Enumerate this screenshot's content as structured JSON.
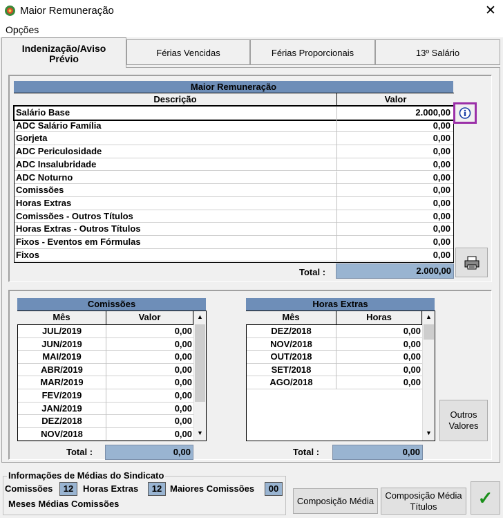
{
  "window": {
    "title": "Maior Remuneração",
    "close": "✕"
  },
  "menu": {
    "opcoes": "Opções"
  },
  "tabs": [
    {
      "label_line1": "Indenização/Aviso",
      "label_line2": "Prévio"
    },
    {
      "label": "Férias Vencidas"
    },
    {
      "label": "Férias Proporcionais"
    },
    {
      "label": "13º Salário"
    }
  ],
  "maior": {
    "title": "Maior Remuneração",
    "col_desc": "Descrição",
    "col_valor": "Valor",
    "rows": [
      {
        "desc": "Salário Base",
        "valor": "2.000,00"
      },
      {
        "desc": "ADC Salário Família",
        "valor": "0,00"
      },
      {
        "desc": "Gorjeta",
        "valor": "0,00"
      },
      {
        "desc": "ADC Periculosidade",
        "valor": "0,00"
      },
      {
        "desc": "ADC Insalubridade",
        "valor": "0,00"
      },
      {
        "desc": "ADC Noturno",
        "valor": "0,00"
      },
      {
        "desc": "Comissões",
        "valor": "0,00"
      },
      {
        "desc": "Horas Extras",
        "valor": "0,00"
      },
      {
        "desc": "Comissões - Outros Títulos",
        "valor": "0,00"
      },
      {
        "desc": "Horas Extras - Outros Títulos",
        "valor": "0,00"
      },
      {
        "desc": "Fixos - Eventos em Fórmulas",
        "valor": "0,00"
      },
      {
        "desc": "Fixos",
        "valor": "0,00"
      }
    ],
    "total_label": "Total :",
    "total_value": "2.000,00"
  },
  "comissoes": {
    "title": "Comissões",
    "col_mes": "Mês",
    "col_valor": "Valor",
    "rows": [
      {
        "mes": "JUL/2019",
        "valor": "0,00"
      },
      {
        "mes": "JUN/2019",
        "valor": "0,00"
      },
      {
        "mes": "MAI/2019",
        "valor": "0,00"
      },
      {
        "mes": "ABR/2019",
        "valor": "0,00"
      },
      {
        "mes": "MAR/2019",
        "valor": "0,00"
      },
      {
        "mes": "FEV/2019",
        "valor": "0,00"
      },
      {
        "mes": "JAN/2019",
        "valor": "0,00"
      },
      {
        "mes": "DEZ/2018",
        "valor": "0,00"
      },
      {
        "mes": "NOV/2018",
        "valor": "0,00"
      }
    ],
    "total_label": "Total :",
    "total_value": "0,00"
  },
  "horas": {
    "title": "Horas Extras",
    "col_mes": "Mês",
    "col_horas": "Horas",
    "rows": [
      {
        "mes": "DEZ/2018",
        "horas": "0,00"
      },
      {
        "mes": "NOV/2018",
        "horas": "0,00"
      },
      {
        "mes": "OUT/2018",
        "horas": "0,00"
      },
      {
        "mes": "SET/2018",
        "horas": "0,00"
      },
      {
        "mes": "AGO/2018",
        "horas": "0,00"
      }
    ],
    "total_label": "Total :",
    "total_value": "0,00"
  },
  "outros_valores": {
    "line1": "Outros",
    "line2": "Valores"
  },
  "sindicato": {
    "title": "Informações de Médias do Sindicato",
    "comissoes_label": "Comissões",
    "comissoes_value": "12",
    "horas_label": "Horas Extras",
    "horas_value": "12",
    "maiores_label": "Maiores Comissões",
    "maiores_value": "00",
    "meses_label": "Meses Médias Comissões"
  },
  "buttons": {
    "composicao_media": "Composição Média",
    "composicao_titulos_line1": "Composição Média",
    "composicao_titulos_line2": "Títulos",
    "ok": "✓"
  },
  "colors": {
    "header": "#6e8eb8",
    "total": "#99b4d1",
    "ok": "#1a8f1a",
    "highlight": "#9b30a8"
  }
}
